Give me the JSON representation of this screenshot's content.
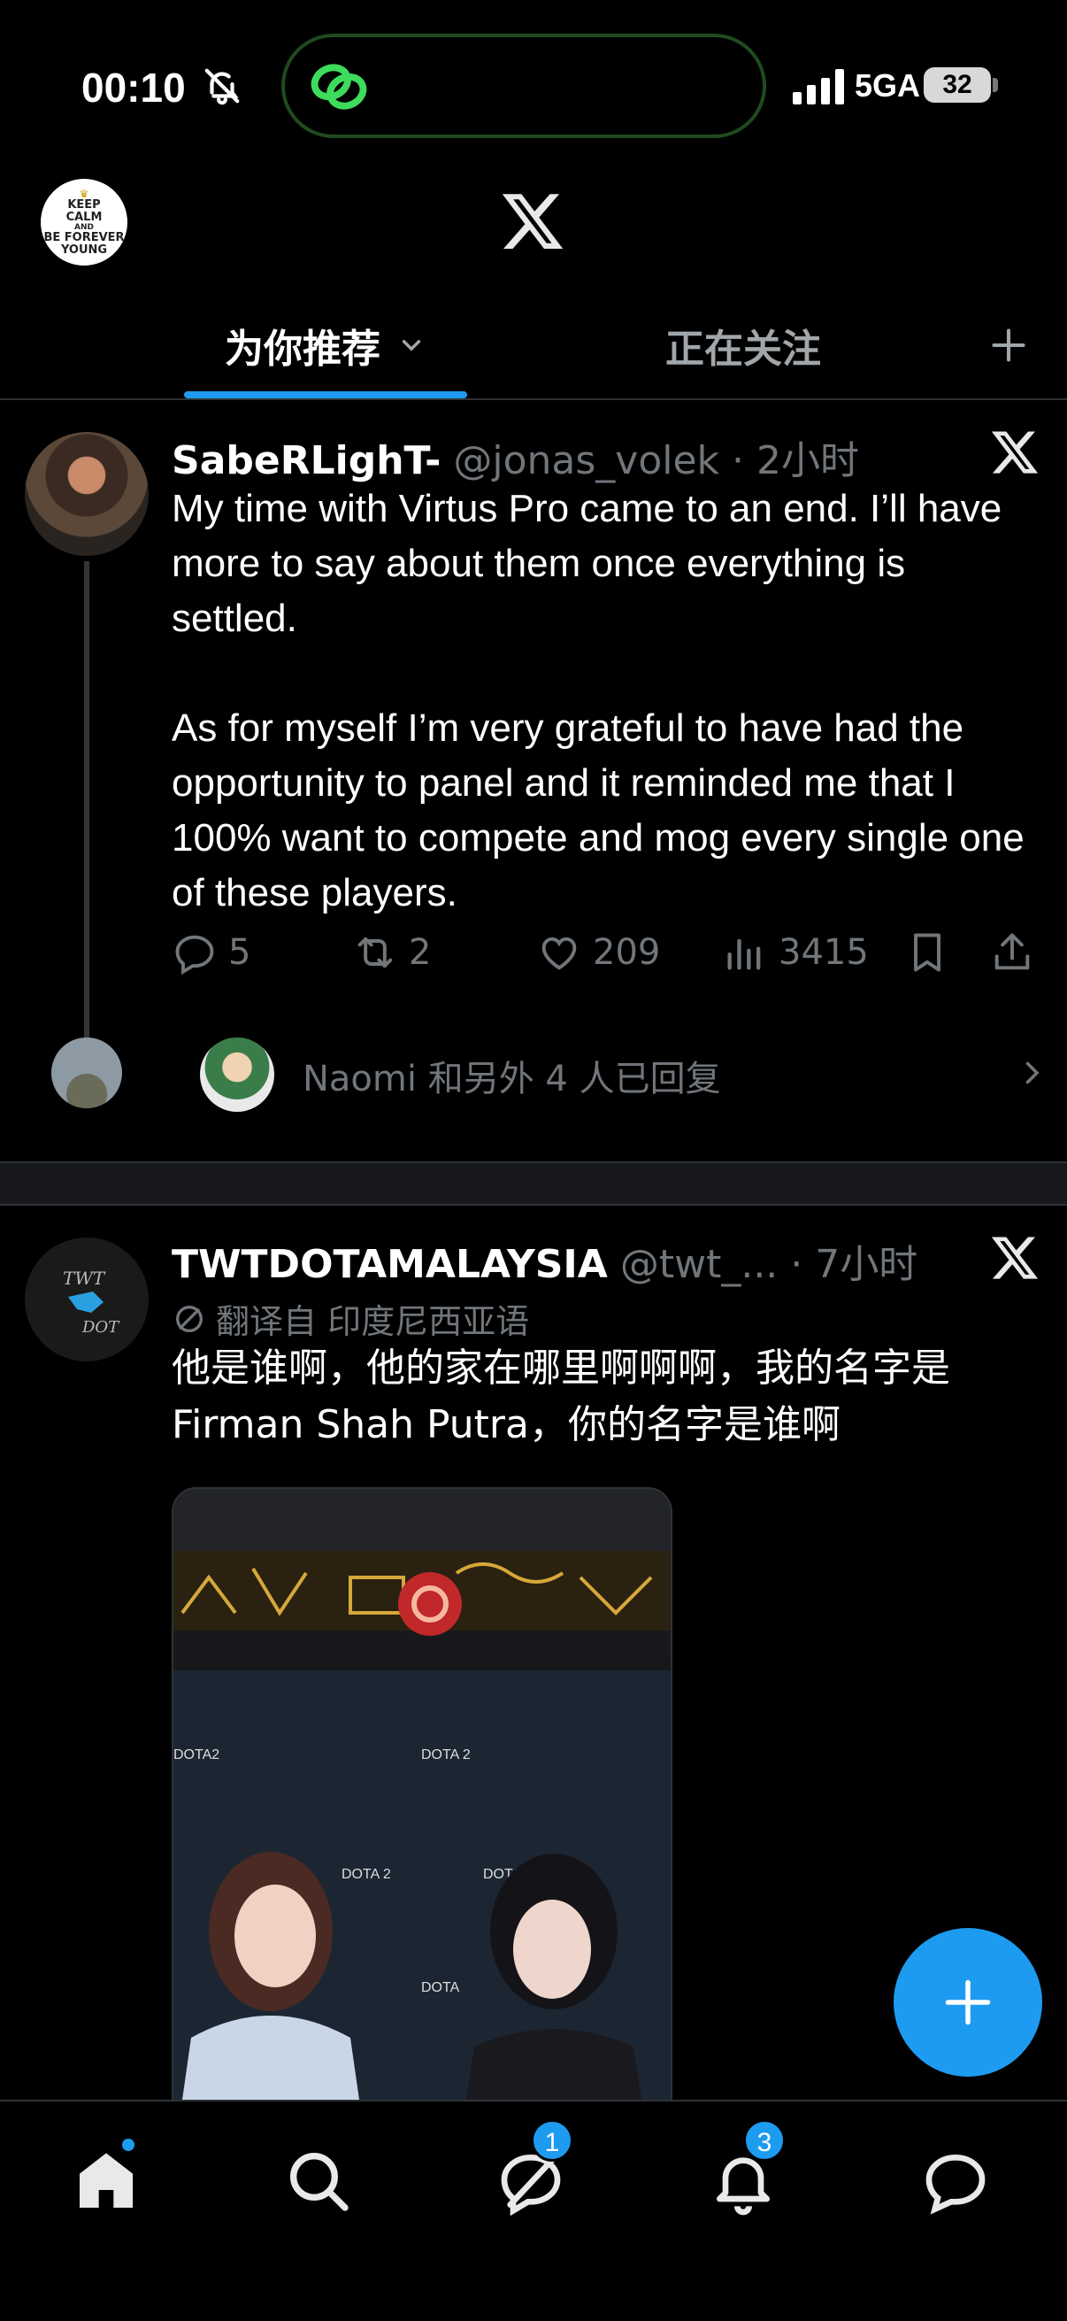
{
  "status_bar": {
    "time": "00:10",
    "network": "5GA",
    "battery": "32"
  },
  "header": {
    "avatar_text": [
      "KEEP",
      "CALM",
      "AND",
      "BE FOREVER",
      "YOUNG"
    ]
  },
  "tabs": {
    "for_you": "为你推荐",
    "following": "正在关注",
    "add": "+"
  },
  "tweet1": {
    "name": "SabeRLighT-",
    "handle": "@jonas_volek",
    "dot": "·",
    "time": "2小时",
    "body": "My time with Virtus Pro came to an end. I’ll have more to say about them once everything is settled.\n\nAs for myself I’m very grateful to have had the opportunity to panel and it reminded me that I 100% want to compete and mog every single one of these players.",
    "replies": "5",
    "reposts": "2",
    "likes": "209",
    "views": "3415",
    "reply_summary": "Naomi 和另外 4 人已回复"
  },
  "tweet2": {
    "name": "TWTDOTAMALAYSIA",
    "handle": "@twt_...",
    "dot": "·",
    "time": "7小时",
    "translated_from": "翻译自 印度尼西亚语",
    "body": "他是谁啊，他的家在哪里啊啊啊，我的名字是Firman Shah Putra，你的名字是谁啊",
    "avatar_text": "TWT DOT",
    "media_labels": [
      "DOTA2",
      "DOTA 2",
      "DOTA 2",
      "DOTA 2",
      "DOTA"
    ]
  },
  "nav": {
    "chat_badge": "1",
    "notifications_badge": "3"
  },
  "colors": {
    "accent": "#1d9bf0",
    "background": "#000000",
    "muted": "#71767b"
  }
}
